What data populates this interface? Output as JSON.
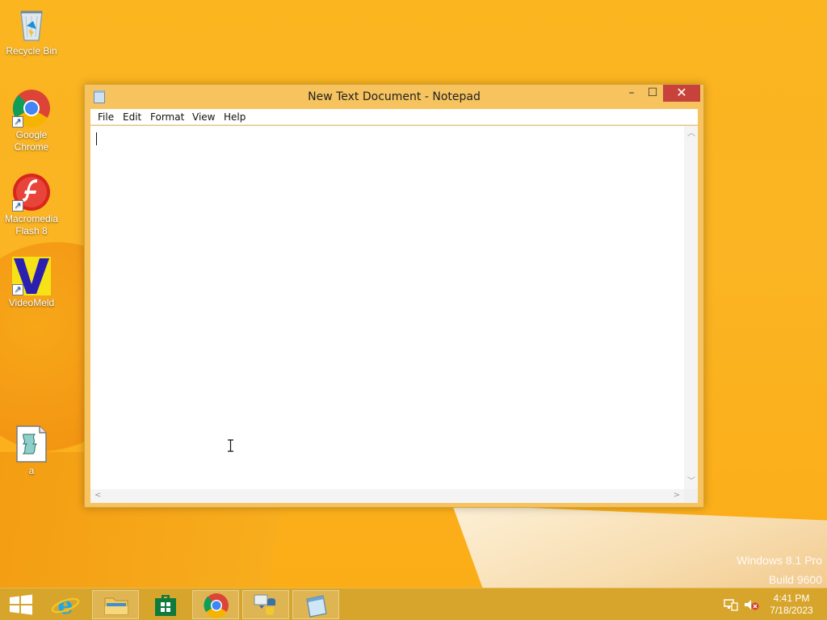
{
  "desktop": {
    "icons": [
      {
        "label": "Recycle Bin",
        "icon": "recycle-bin-icon"
      },
      {
        "label": "Google Chrome",
        "icon": "chrome-icon",
        "shortcut": true
      },
      {
        "label": "Macromedia Flash 8",
        "icon": "flash-icon",
        "shortcut": true
      },
      {
        "label": "VideoMeld",
        "icon": "videomeld-icon",
        "shortcut": true
      },
      {
        "label": "a",
        "icon": "script-file-icon"
      }
    ],
    "watermark": {
      "line1": "Windows 8.1 Pro",
      "line2": "Build 9600"
    }
  },
  "window": {
    "title": "New Text Document - Notepad",
    "controls": {
      "minimize": "–",
      "maximize": "☐",
      "close": "✕"
    },
    "menu": [
      "File",
      "Edit",
      "Format",
      "View",
      "Help"
    ],
    "content": ""
  },
  "taskbar": {
    "buttons": [
      {
        "name": "start",
        "icon": "windows-logo-icon"
      },
      {
        "name": "internet-explorer",
        "icon": "ie-icon"
      },
      {
        "name": "file-explorer",
        "icon": "folder-icon"
      },
      {
        "name": "store",
        "icon": "store-icon"
      },
      {
        "name": "chrome",
        "icon": "chrome-icon"
      },
      {
        "name": "python",
        "icon": "python-icon"
      },
      {
        "name": "notepad",
        "icon": "notepad-icon",
        "active": true
      }
    ],
    "tray": {
      "time": "4:41 PM",
      "date": "7/18/2023"
    }
  },
  "colors": {
    "desktop": "#fbb21f",
    "window_frame": "#f6c35e",
    "close_button": "#c7423a",
    "taskbar": "#d7a52c"
  }
}
